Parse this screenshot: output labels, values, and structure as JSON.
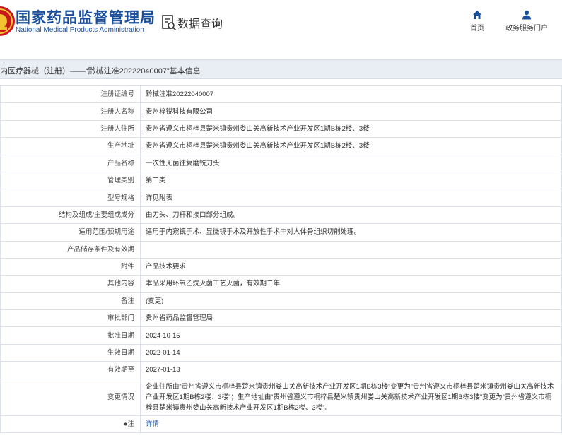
{
  "header": {
    "logo_cn": "国家药品监督管理局",
    "logo_en": "National Medical Products Administration",
    "query_title": "数据查询",
    "nav": [
      {
        "label": "首页",
        "icon": "home-icon"
      },
      {
        "label": "政务服务门户",
        "icon": "user-icon"
      }
    ]
  },
  "colors": {
    "brand": "#1b4f9b",
    "title_bar": "#e9edf4",
    "link": "#1e5fb3"
  },
  "title_bar": {
    "text": "内医疗器械（注册）——“黔械注准20222040007”基本信息"
  },
  "rows": [
    {
      "label": "注册证编号",
      "value": "黔械注准20222040007"
    },
    {
      "label": "注册人名称",
      "value": "贵州梓锐科技有限公司"
    },
    {
      "label": "注册人住所",
      "value": "贵州省遵义市桐梓县楚米镇贵州娄山关高新技术产业开发区1期B栋2楼、3楼"
    },
    {
      "label": "生产地址",
      "value": "贵州省遵义市桐梓县楚米镇贵州娄山关高新技术产业开发区1期B栋2楼、3楼"
    },
    {
      "label": "产品名称",
      "value": "一次性无菌往复磨铣刀头"
    },
    {
      "label": "管理类别",
      "value": "第二类"
    },
    {
      "label": "型号规格",
      "value": "详见附表"
    },
    {
      "label": "结构及组成/主要组成成分",
      "value": "由刀头、刀杆和接口部分组成。"
    },
    {
      "label": "适用范围/预期用途",
      "value": "适用于内窥镜手术、显微镜手术及开放性手术中对人体骨组织切削处理。"
    },
    {
      "label": "产品储存条件及有效期",
      "value": ""
    },
    {
      "label": "附件",
      "value": "产品技术要求"
    },
    {
      "label": "其他内容",
      "value": "本品采用环氧乙烷灭菌工艺灭菌，有效期二年"
    },
    {
      "label": "备注",
      "value": "(变更)"
    },
    {
      "label": "审批部门",
      "value": "贵州省药品监督管理局"
    },
    {
      "label": "批准日期",
      "value": "2024-10-15"
    },
    {
      "label": "生效日期",
      "value": "2022-01-14"
    },
    {
      "label": "有效期至",
      "value": "2027-01-13"
    },
    {
      "label": "变更情况",
      "value": "企业住所由“贵州省遵义市桐梓县楚米镇贵州娄山关高新技术产业开发区1期B栋3楼”变更为“贵州省遵义市桐梓县楚米镇贵州娄山关高新技术产业开发区1期B栋2楼、3楼”；生产地址由“贵州省遵义市桐梓县楚米镇贵州娄山关高新技术产业开发区1期B栋3楼”变更为“贵州省遵义市桐梓县楚米镇贵州娄山关高新技术产业开发区1期B栋2楼、3楼”。"
    },
    {
      "label": "●注",
      "value": "详情"
    }
  ]
}
